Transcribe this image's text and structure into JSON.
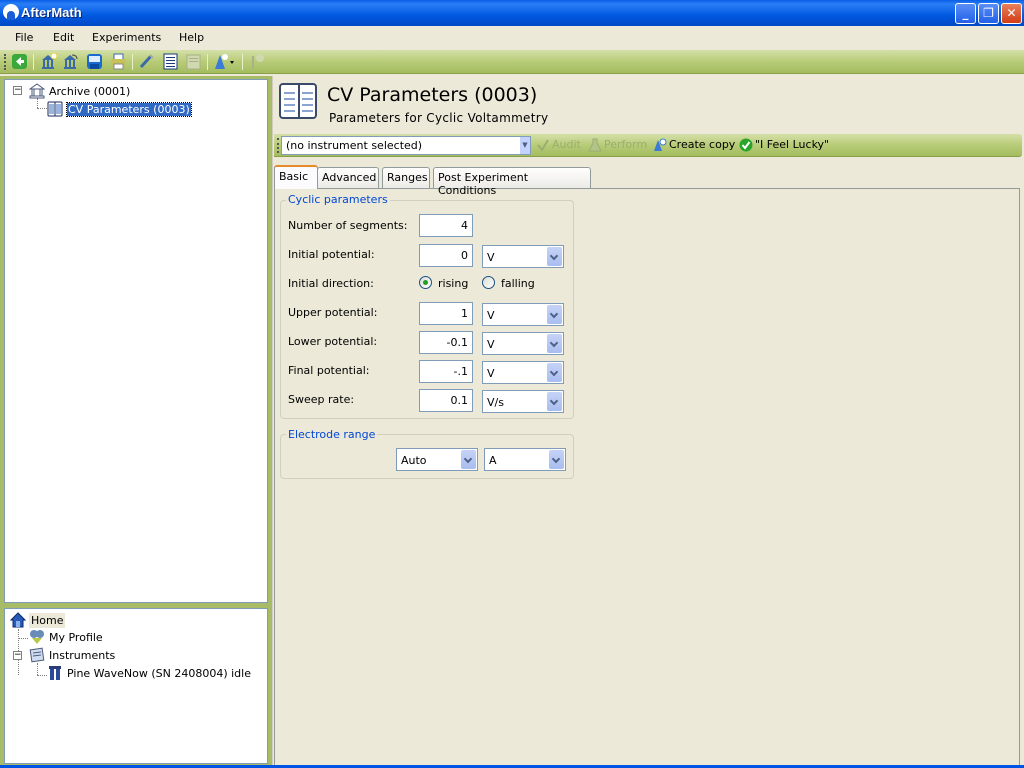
{
  "window": {
    "title": "AfterMath",
    "controls": {
      "minimize": "_",
      "restore": "❐",
      "close": "✕"
    }
  },
  "menu": [
    "File",
    "Edit",
    "Experiments",
    "Help"
  ],
  "toolbar": {
    "icons": [
      "back-icon",
      "new-archive-icon",
      "open-archive-icon",
      "save-icon",
      "print-icon",
      "edit-icon",
      "copy-icon",
      "paste-icon",
      "wizard-dropdown-icon",
      "disabled-tool-icon"
    ]
  },
  "archive_tree": {
    "nodes": [
      {
        "label": "Archive (0001)",
        "icon": "archive-icon",
        "expanded": true
      },
      {
        "label": "CV Parameters (0003)",
        "icon": "parameters-book-icon",
        "selected": true
      }
    ]
  },
  "home_tree": {
    "nodes": [
      {
        "label": "Home",
        "icon": "home-icon"
      },
      {
        "label": "My Profile",
        "icon": "profile-icon"
      },
      {
        "label": "Instruments",
        "icon": "instruments-icon",
        "expanded": true
      },
      {
        "label": "Pine WaveNow (SN 2408004) idle",
        "icon": "instrument-icon"
      }
    ]
  },
  "header": {
    "title": "CV Parameters (0003)",
    "subtitle": "Parameters for Cyclic Voltammetry"
  },
  "action_bar": {
    "instrument_select": "(no instrument selected)",
    "audit": "Audit",
    "perform": "Perform",
    "create_copy": "Create copy",
    "feel_lucky": "\"I Feel Lucky\""
  },
  "tabs": [
    {
      "label": "Basic",
      "active": true
    },
    {
      "label": "Advanced"
    },
    {
      "label": "Ranges"
    },
    {
      "label": "Post Experiment Conditions"
    }
  ],
  "cyclic": {
    "title": "Cyclic parameters",
    "segments_label": "Number of segments:",
    "segments_value": "4",
    "initial_potential_label": "Initial potential:",
    "initial_potential_value": "0",
    "initial_potential_unit": "V",
    "initial_direction_label": "Initial direction:",
    "direction_rising": "rising",
    "direction_falling": "falling",
    "direction_selected": "rising",
    "upper_potential_label": "Upper potential:",
    "upper_potential_value": "1",
    "upper_potential_unit": "V",
    "lower_potential_label": "Lower potential:",
    "lower_potential_value": "-0.1",
    "lower_potential_unit": "V",
    "final_potential_label": "Final potential:",
    "final_potential_value": "-.1",
    "final_potential_unit": "V",
    "sweep_rate_label": "Sweep rate:",
    "sweep_rate_value": "0.1",
    "sweep_rate_unit": "V/s"
  },
  "electrode": {
    "title": "Electrode range",
    "range_mode": "Auto",
    "range_unit": "A"
  },
  "colors": {
    "titlebar": "#0058e0",
    "toolbar_green": "#b8cc78",
    "selection": "#316ac5",
    "group_title": "#0046d5",
    "tab_accent": "#e68b2c"
  }
}
